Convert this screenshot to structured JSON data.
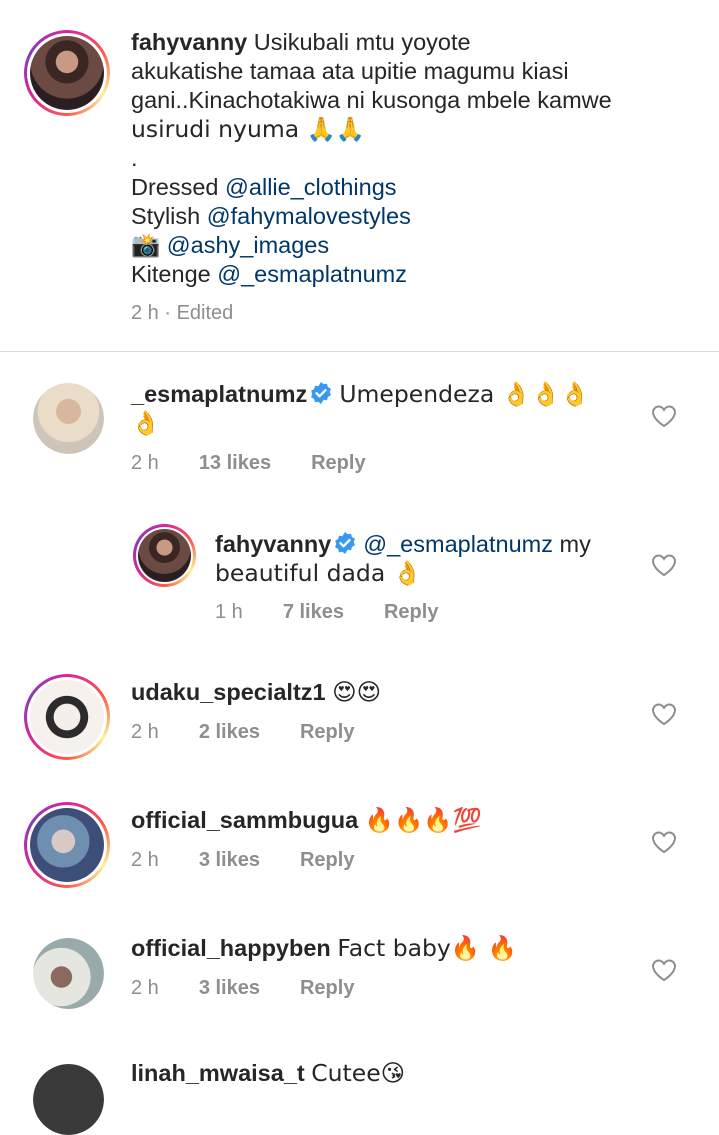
{
  "caption": {
    "username": "fahyvanny",
    "line1": "Usikubali mtu yoyote",
    "line2": "akukatishe tamaa ata upitie magumu kiasi",
    "line3": "gani..Kinachotakiwa ni kusonga mbele kamwe",
    "line4": "usirudi nyuma 🙏🙏",
    "dot": ".",
    "dressed_label": "Dressed",
    "dressed_handle": "@allie_clothings",
    "stylish_label": "Stylish",
    "stylish_handle": "@fahymalovestyles",
    "camera_emoji": "📸",
    "photo_handle": "@ashy_images",
    "kitenge_label": "Kitenge",
    "kitenge_handle": "@_esmaplatnumz",
    "time": "2 h",
    "edited": "Edited"
  },
  "comments": [
    {
      "username": "_esmaplatnumz",
      "text_a": "Umependeza 👌👌👌",
      "text_b": "👌",
      "time": "2 h",
      "likes": "13 likes",
      "reply": "Reply"
    },
    {
      "username": "fahyvanny",
      "mention": "@_esmaplatnumz",
      "text_a": " my",
      "text_b": "beautiful dada 👌",
      "time": "1 h",
      "likes": "7 likes",
      "reply": "Reply"
    },
    {
      "username": "udaku_specialtz1",
      "text_a": "😍😍",
      "time": "2 h",
      "likes": "2 likes",
      "reply": "Reply"
    },
    {
      "username": "official_sammbugua",
      "text_a": "🔥🔥🔥💯",
      "time": "2 h",
      "likes": "3 likes",
      "reply": "Reply"
    },
    {
      "username": "official_happyben",
      "text_a": "Fact baby🔥 🔥",
      "time": "2 h",
      "likes": "3 likes",
      "reply": "Reply"
    },
    {
      "username": "linah_mwaisa_t",
      "text_a": "Cutee😘"
    }
  ],
  "colors": {
    "text": "#262626",
    "meta": "#8e8e8e",
    "mention": "#00376b",
    "verified": "#3897f0"
  }
}
